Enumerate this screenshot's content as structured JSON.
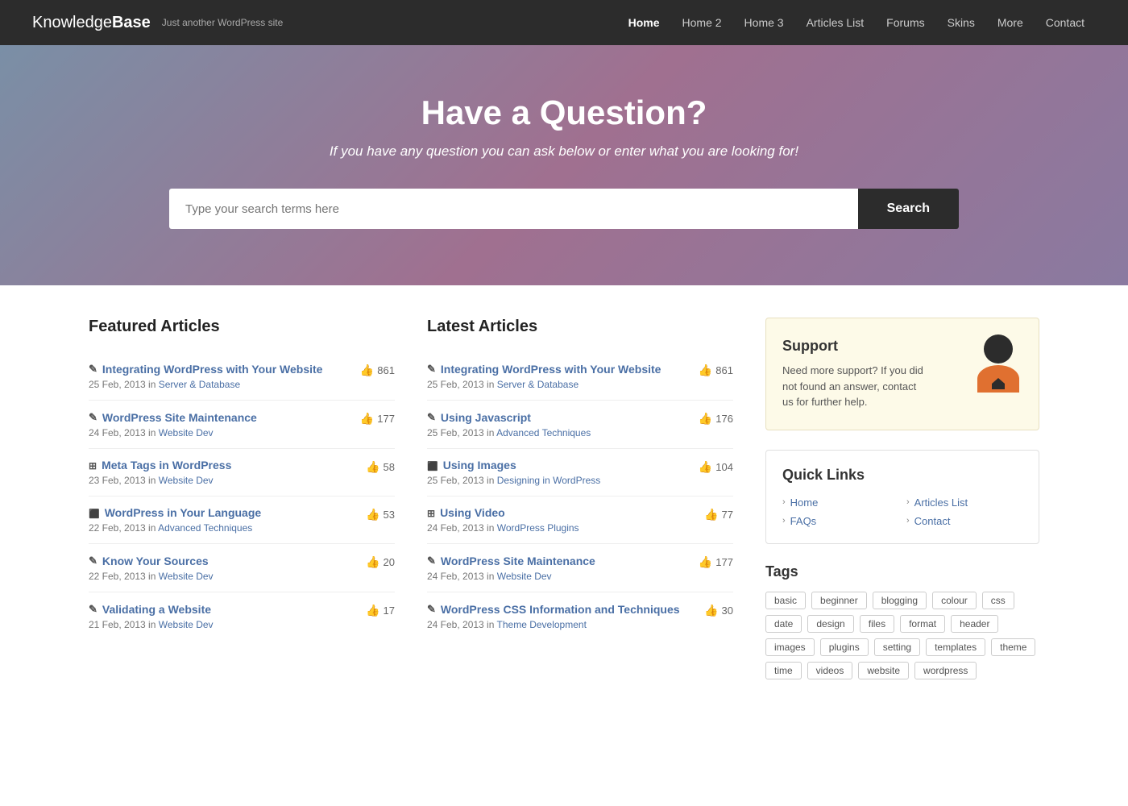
{
  "site": {
    "brand_name_part1": "Knowledge",
    "brand_name_part2": "Base",
    "tagline": "Just another WordPress site"
  },
  "nav": {
    "items": [
      {
        "label": "Home",
        "active": true
      },
      {
        "label": "Home 2",
        "active": false
      },
      {
        "label": "Home 3",
        "active": false
      },
      {
        "label": "Articles List",
        "active": false
      },
      {
        "label": "Forums",
        "active": false
      },
      {
        "label": "Skins",
        "active": false
      },
      {
        "label": "More",
        "active": false
      },
      {
        "label": "Contact",
        "active": false
      }
    ]
  },
  "hero": {
    "title": "Have a Question?",
    "subtitle": "If you have any question you can ask below or enter what you are looking for!",
    "search_placeholder": "Type your search terms here",
    "search_button": "Search"
  },
  "featured_articles": {
    "section_title": "Featured Articles",
    "items": [
      {
        "icon": "edit",
        "title": "Integrating WordPress with Your Website",
        "date": "25 Feb, 2013",
        "category": "Server & Database",
        "likes": 861
      },
      {
        "icon": "edit",
        "title": "WordPress Site Maintenance",
        "date": "24 Feb, 2013",
        "category": "Website Dev",
        "likes": 177
      },
      {
        "icon": "table",
        "title": "Meta Tags in WordPress",
        "date": "23 Feb, 2013",
        "category": "Website Dev",
        "likes": 58
      },
      {
        "icon": "image",
        "title": "WordPress in Your Language",
        "date": "22 Feb, 2013",
        "category": "Advanced Techniques",
        "likes": 53
      },
      {
        "icon": "edit",
        "title": "Know Your Sources",
        "date": "22 Feb, 2013",
        "category": "Website Dev",
        "likes": 20
      },
      {
        "icon": "edit",
        "title": "Validating a Website",
        "date": "21 Feb, 2013",
        "category": "Website Dev",
        "likes": 17
      }
    ]
  },
  "latest_articles": {
    "section_title": "Latest Articles",
    "items": [
      {
        "icon": "edit",
        "title": "Integrating WordPress with Your Website",
        "date": "25 Feb, 2013",
        "category": "Server & Database",
        "likes": 861
      },
      {
        "icon": "edit",
        "title": "Using Javascript",
        "date": "25 Feb, 2013",
        "category": "Advanced Techniques",
        "likes": 176
      },
      {
        "icon": "image",
        "title": "Using Images",
        "date": "25 Feb, 2013",
        "category": "Designing in WordPress",
        "likes": 104
      },
      {
        "icon": "table",
        "title": "Using Video",
        "date": "24 Feb, 2013",
        "category": "WordPress Plugins",
        "likes": 77
      },
      {
        "icon": "edit",
        "title": "WordPress Site Maintenance",
        "date": "24 Feb, 2013",
        "category": "Website Dev",
        "likes": 177
      },
      {
        "icon": "edit",
        "title": "WordPress CSS Information and Techniques",
        "date": "24 Feb, 2013",
        "category": "Theme Development",
        "likes": 30
      }
    ]
  },
  "support": {
    "title": "Support",
    "description": "Need more support? If you did not found an answer, contact us for further help."
  },
  "quick_links": {
    "title": "Quick Links",
    "links": [
      {
        "label": "Home"
      },
      {
        "label": "Articles List"
      },
      {
        "label": "FAQs"
      },
      {
        "label": "Contact"
      }
    ]
  },
  "tags": {
    "title": "Tags",
    "items": [
      "basic",
      "beginner",
      "blogging",
      "colour",
      "css",
      "date",
      "design",
      "files",
      "format",
      "header",
      "images",
      "plugins",
      "setting",
      "templates",
      "theme",
      "time",
      "videos",
      "website",
      "wordpress"
    ]
  }
}
